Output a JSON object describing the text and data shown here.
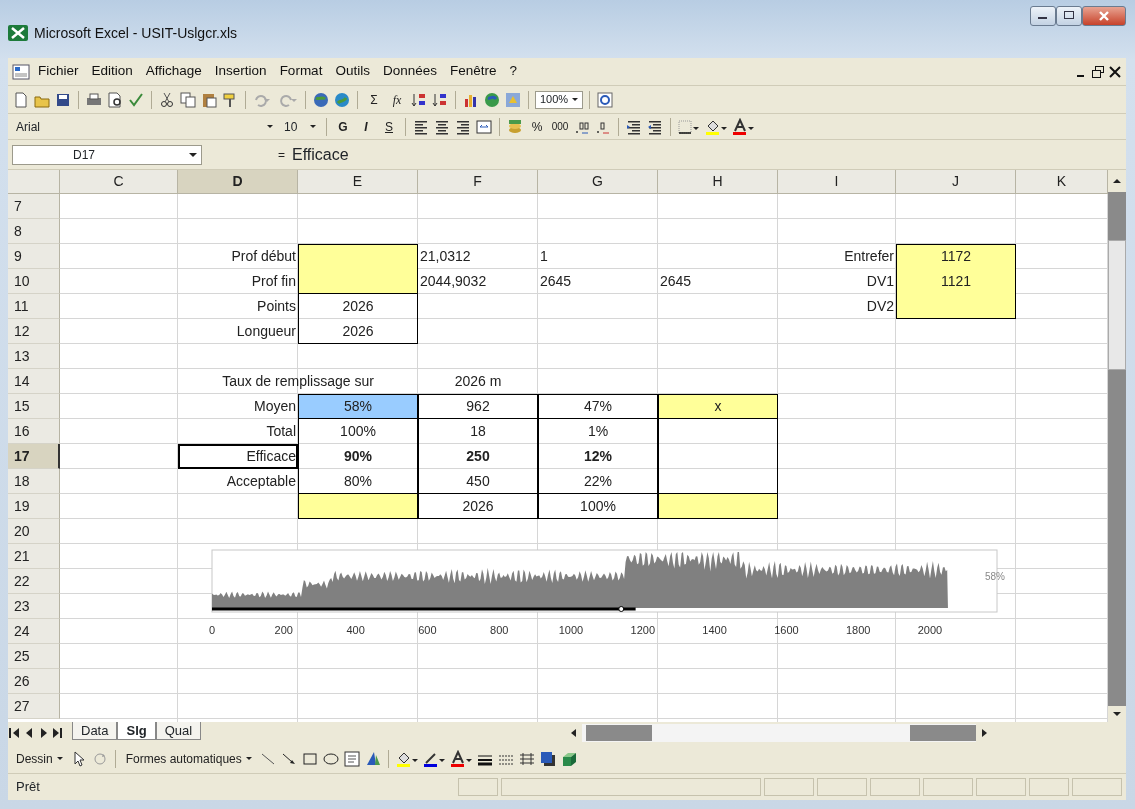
{
  "window": {
    "title": "Microsoft Excel - USIT-Uslgcr.xls"
  },
  "menu": [
    "Fichier",
    "Edition",
    "Affichage",
    "Insertion",
    "Format",
    "Outils",
    "Données",
    "Fenêtre",
    "?"
  ],
  "standard_toolbar": {
    "sum": "Σ",
    "function": "fx",
    "zoom": "100%"
  },
  "format_toolbar": {
    "font": "Arial",
    "size": "10",
    "bold": "G",
    "italic": "I",
    "underline": "S",
    "percent": "%",
    "thousands": "000"
  },
  "formula_bar": {
    "name_box": "D17",
    "equals": "=",
    "content": "Efficace"
  },
  "columns": [
    {
      "label": "C",
      "selected": false
    },
    {
      "label": "D",
      "selected": true
    },
    {
      "label": "E",
      "selected": false
    },
    {
      "label": "F",
      "selected": false
    },
    {
      "label": "G",
      "selected": false
    },
    {
      "label": "H",
      "selected": false
    },
    {
      "label": "I",
      "selected": false
    },
    {
      "label": "J",
      "selected": false
    },
    {
      "label": "K",
      "selected": false
    }
  ],
  "rows": [
    {
      "number": "7",
      "selected": false
    },
    {
      "number": "8",
      "selected": false
    },
    {
      "number": "9",
      "selected": false,
      "cells": [
        {},
        {
          "kind": "label",
          "text": "Prof début"
        },
        {
          "kind": "blank",
          "color": "#ffff99",
          "border_top": true,
          "border_left": true,
          "border_right": true
        },
        {
          "kind": "text",
          "text": "21,0312"
        },
        {
          "kind": "text",
          "text": "1"
        },
        {},
        {
          "kind": "label",
          "text": "Entrefer"
        },
        {
          "kind": "number",
          "text": "1172",
          "color": "#ffff99",
          "border_top": true,
          "border_left": true,
          "border_right": true
        },
        {}
      ]
    },
    {
      "number": "10",
      "selected": false,
      "cells": [
        {},
        {
          "kind": "label",
          "text": "Prof fin"
        },
        {
          "kind": "blank",
          "color": "#ffff99",
          "border_bottom": true,
          "border_left": true,
          "border_right": true
        },
        {
          "kind": "text",
          "text": "2044,9032"
        },
        {
          "kind": "text",
          "text": "2645"
        },
        {
          "kind": "text",
          "text": "2645"
        },
        {
          "kind": "label",
          "text": "DV1"
        },
        {
          "kind": "number",
          "text": "1121",
          "color": "#ffff99",
          "border_left": true,
          "border_right": true
        },
        {}
      ]
    },
    {
      "number": "11",
      "selected": false,
      "cells": [
        {},
        {
          "kind": "label",
          "text": "Points"
        },
        {
          "kind": "number",
          "text": "2026",
          "border_left": true,
          "border_right": true
        },
        {},
        {},
        {},
        {
          "kind": "label",
          "text": "DV2"
        },
        {
          "kind": "blank",
          "color": "#ffff99",
          "border_bottom": true,
          "border_left": true,
          "border_right": true
        },
        {}
      ]
    },
    {
      "number": "12",
      "selected": false,
      "cells": [
        {},
        {
          "kind": "label",
          "text": "Longueur"
        },
        {
          "kind": "number",
          "text": "2026",
          "border_bottom": true,
          "border_left": true,
          "border_right": true
        },
        {},
        {},
        {},
        {},
        {},
        {}
      ]
    },
    {
      "number": "13",
      "selected": false
    },
    {
      "number": "14",
      "selected": false,
      "cells": [
        {},
        {
          "kind": "heading",
          "text": "Taux de remplissage sur"
        },
        {
          "kind": "number",
          "text": "2026 m"
        },
        {},
        {},
        {},
        {},
        {}
      ]
    },
    {
      "number": "15",
      "selected": false,
      "cells": [
        {},
        {
          "kind": "label",
          "text": "Moyen"
        },
        {
          "kind": "number",
          "text": "58%",
          "color": "#99ccff",
          "border_top": true,
          "border_bottom": true,
          "border_left": true,
          "border_right": true
        },
        {
          "kind": "number",
          "text": "962",
          "border_top": true,
          "border_bottom": true,
          "border_left": true,
          "border_right": true
        },
        {
          "kind": "number",
          "text": "47%",
          "border_top": true,
          "border_bottom": true,
          "border_left": true,
          "border_right": true
        },
        {
          "kind": "number",
          "text": "x",
          "color": "#ffff99",
          "border_top": true,
          "border_bottom": true,
          "border_left": true,
          "border_right": true
        },
        {},
        {},
        {}
      ]
    },
    {
      "number": "16",
      "selected": false,
      "cells": [
        {},
        {
          "kind": "label",
          "text": "Total"
        },
        {
          "kind": "number",
          "text": "100%",
          "border_left": true,
          "border_right": true
        },
        {
          "kind": "number",
          "text": "18",
          "border_left": true,
          "border_right": true
        },
        {
          "kind": "number",
          "text": "1%",
          "border_left": true,
          "border_right": true
        },
        {
          "kind": "blank",
          "border_left": true,
          "border_right": true
        },
        {},
        {},
        {}
      ]
    },
    {
      "number": "17",
      "selected": true,
      "cells": [
        {},
        {
          "kind": "label",
          "text": "Efficace",
          "active": true
        },
        {
          "kind": "number",
          "text": "90%",
          "bold": true,
          "border_left": true,
          "border_right": true
        },
        {
          "kind": "number",
          "text": "250",
          "bold": true,
          "border_left": true,
          "border_right": true
        },
        {
          "kind": "number",
          "text": "12%",
          "bold": true,
          "border_left": true,
          "border_right": true
        },
        {
          "kind": "blank",
          "border_left": true,
          "border_right": true
        },
        {},
        {},
        {}
      ]
    },
    {
      "number": "18",
      "selected": false,
      "cells": [
        {},
        {
          "kind": "label",
          "text": "Acceptable"
        },
        {
          "kind": "number",
          "text": "80%",
          "border_bottom": true,
          "border_left": true,
          "border_right": true
        },
        {
          "kind": "number",
          "text": "450",
          "border_bottom": true,
          "border_left": true,
          "border_right": true
        },
        {
          "kind": "number",
          "text": "22%",
          "border_bottom": true,
          "border_left": true,
          "border_right": true
        },
        {
          "kind": "blank",
          "border_bottom": true,
          "border_left": true,
          "border_right": true
        },
        {},
        {},
        {}
      ]
    },
    {
      "number": "19",
      "selected": false,
      "cells": [
        {},
        {},
        {
          "kind": "blank",
          "color": "#ffff99",
          "border_bottom": true,
          "border_left": true,
          "border_right": true
        },
        {
          "kind": "number",
          "text": "2026",
          "border_bottom": true,
          "border_left": true,
          "border_right": true
        },
        {
          "kind": "number",
          "text": "100%",
          "border_bottom": true,
          "border_left": true,
          "border_right": true
        },
        {
          "kind": "blank",
          "color": "#ffff99",
          "border_bottom": true,
          "border_left": true,
          "border_right": true
        },
        {},
        {},
        {}
      ]
    },
    {
      "number": "20",
      "selected": false
    },
    {
      "number": "21",
      "selected": false
    },
    {
      "number": "22",
      "selected": false
    },
    {
      "number": "23",
      "selected": false
    },
    {
      "number": "24",
      "selected": false
    },
    {
      "number": "25",
      "selected": false
    },
    {
      "number": "26",
      "selected": false
    },
    {
      "number": "27",
      "selected": false
    }
  ],
  "chart": {
    "x_tick_labels": [
      "0",
      "200",
      "400",
      "600",
      "800",
      "1000",
      "1200",
      "1400",
      "1600",
      "1800",
      "2000"
    ],
    "side_label": "58%"
  },
  "sheet_tabs": [
    {
      "label": "Data",
      "selected": false
    },
    {
      "label": "Slg",
      "selected": true
    },
    {
      "label": "Qual",
      "selected": false
    }
  ],
  "drawing_toolbar": {
    "draw_menu": "Dessin",
    "autoshapes_menu": "Formes automatiques"
  },
  "status_bar": {
    "text": "Prêt"
  }
}
